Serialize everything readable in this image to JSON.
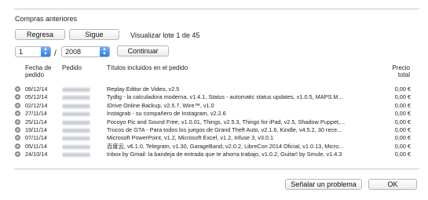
{
  "header": {
    "title": "Compras anteriores"
  },
  "nav": {
    "prev_label": "Regresa",
    "next_label": "Sigue",
    "batch_info": "Visualizar lote 1 de 45"
  },
  "filters": {
    "month_value": "1",
    "separator": "/",
    "year_value": "2008",
    "continue_label": "Continuar"
  },
  "columns": {
    "date": [
      "Fecha de",
      "pedido"
    ],
    "order": "Pedido",
    "titles": "Títulos incluidos en el pedido",
    "price": [
      "Precio",
      "total"
    ]
  },
  "rows": [
    {
      "date": "09/12/14",
      "titles": "Replay Editor de Video, v2.5",
      "price": "0,00 €"
    },
    {
      "date": "05/12/14",
      "titles": "Tydlig - la calculadora moderna, v1.4.1, Status - automatic status updates, v1.0.5, MAPS.M...",
      "price": "0,00 €"
    },
    {
      "date": "02/12/14",
      "titles": "IDrive Online Backup, v2.5.7, Wire™, v1.0",
      "price": "0,00 €"
    },
    {
      "date": "27/11/14",
      "titles": "Instagrab - su compañero de Instagram, v2.2.6",
      "price": "0,00 €"
    },
    {
      "date": "25/11/14",
      "titles": "Pocoyo Pic and Sound Free, v1.0.01, Things, v2.5.3, Things for iPad, v2.5, Shadow Puppet,...",
      "price": "0,00 €"
    },
    {
      "date": "19/11/14",
      "titles": "Trucos de GTA - Para todos los juegos de Grand Theft Auto, v2.1.6, Kindle, v4.5.2, 30 rece...",
      "price": "0,00 €"
    },
    {
      "date": "07/11/14",
      "titles": "Microsoft PowerPoint, v1.2, Microsoft Excel, v1.2, Infuse 3, v3.0.1",
      "price": "0,00 €"
    },
    {
      "date": "05/11/14",
      "titles": "百度云, v6.1.0, Telegram, v1.30, GarageBand, v2.0.2, LibreCon 2014 Oficial, v1.0.13, Micro...",
      "price": "0,00 €"
    },
    {
      "date": "24/10/14",
      "titles": "Inbox by Gmail: la bandeja de entrada que te ahorra trabajo, v1.0.2, Guitar! by Smule, v1.4.3",
      "price": "0,00 €"
    }
  ],
  "footer": {
    "report_label": "Señalar un problema",
    "ok_label": "OK"
  }
}
